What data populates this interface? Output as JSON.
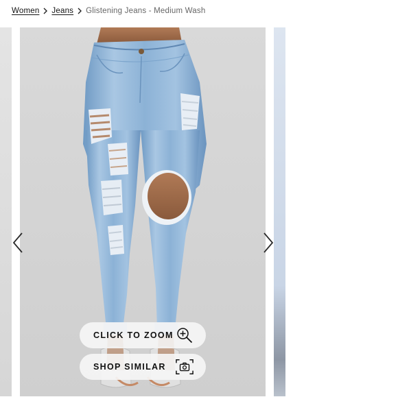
{
  "breadcrumb": {
    "items": [
      {
        "label": "Women"
      },
      {
        "label": "Jeans"
      }
    ],
    "current": "Glistening Jeans - Medium Wash"
  },
  "gallery": {
    "zoom_button": {
      "label": "CLICK TO ZOOM",
      "icon": "zoom-in-icon"
    },
    "similar_button": {
      "label": "SHOP SIMILAR",
      "icon": "camera-icon"
    },
    "prev_icon": "chevron-left-icon",
    "next_icon": "chevron-right-icon"
  },
  "colors": {
    "background": "#ffffff",
    "photo_bg": "#d6d6d6",
    "denim": "#8fb4d8",
    "text": "#111111",
    "muted_text": "#666666"
  }
}
